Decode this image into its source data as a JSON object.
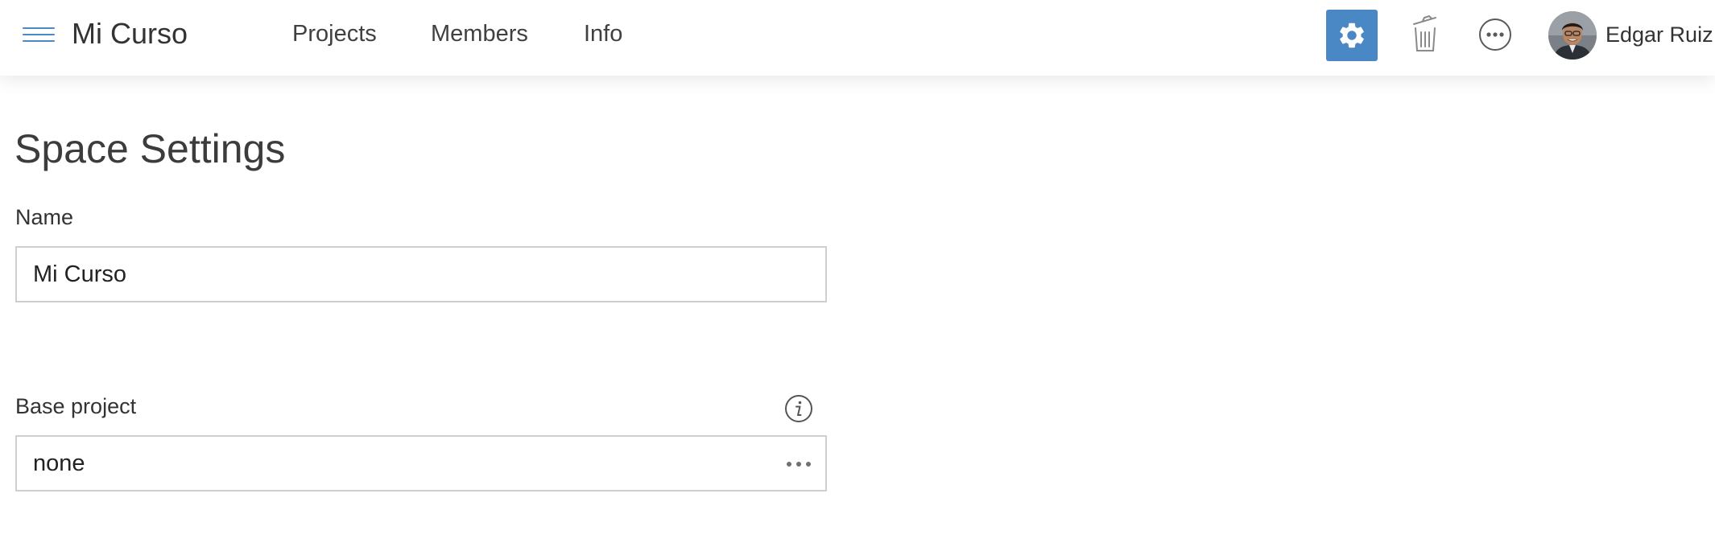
{
  "header": {
    "space_title": "Mi Curso",
    "nav": {
      "projects": "Projects",
      "members": "Members",
      "info": "Info"
    },
    "user_name": "Edgar Ruiz"
  },
  "icons": {
    "menu": "hamburger-icon",
    "settings": "gear-icon",
    "trash": "trash-icon",
    "more": "ellipsis-circle-icon",
    "info": "info-icon",
    "field_more": "ellipsis-icon"
  },
  "colors": {
    "accent": "#4a87c5",
    "border": "#cfcfcf",
    "text": "#333333"
  },
  "main": {
    "page_title": "Space Settings",
    "name_field": {
      "label": "Name",
      "value": "Mi Curso"
    },
    "base_project_field": {
      "label": "Base project",
      "value": "none"
    }
  }
}
